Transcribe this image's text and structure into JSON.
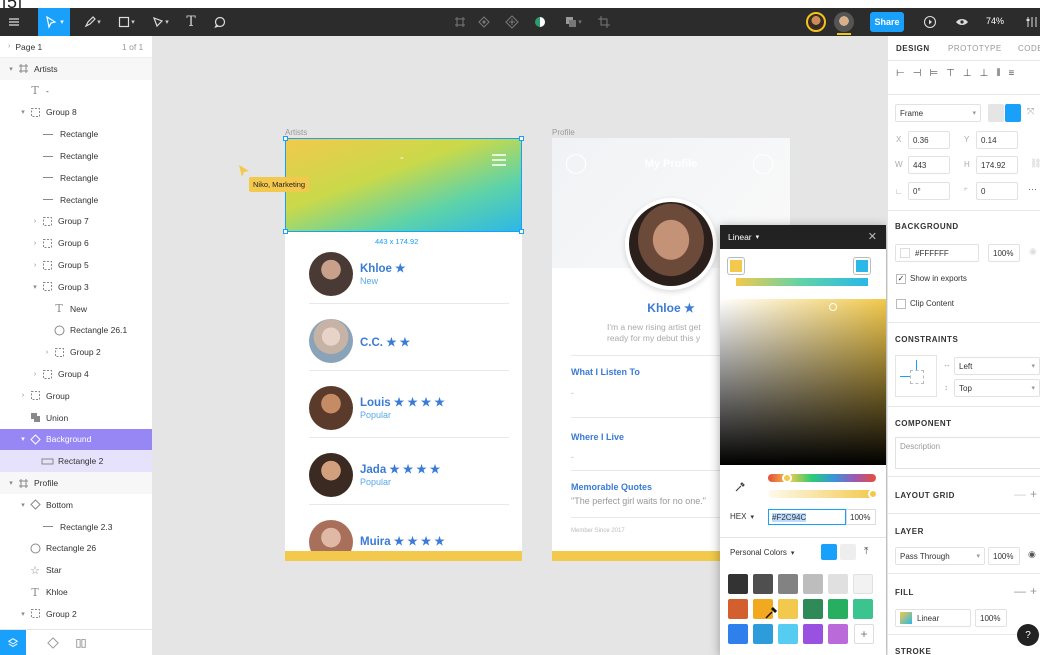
{
  "toolbar": {
    "share_label": "Share",
    "zoom": "74%"
  },
  "left_panel": {
    "page_name": "Page 1",
    "page_count": "1 of 1",
    "layers": [
      {
        "label": "Artists",
        "depth": 0,
        "icon": "frame-icon",
        "arrow": "▾",
        "state": "frame"
      },
      {
        "label": "-",
        "depth": 1,
        "icon": "text-icon",
        "arrow": "",
        "state": ""
      },
      {
        "label": "Group 8",
        "depth": 1,
        "icon": "group-icon",
        "arrow": "▾",
        "state": ""
      },
      {
        "label": "Rectangle",
        "depth": 2,
        "icon": "line-icon",
        "arrow": "",
        "state": ""
      },
      {
        "label": "Rectangle",
        "depth": 2,
        "icon": "line-icon",
        "arrow": "",
        "state": ""
      },
      {
        "label": "Rectangle",
        "depth": 2,
        "icon": "line-icon",
        "arrow": "",
        "state": ""
      },
      {
        "label": "Rectangle",
        "depth": 2,
        "icon": "line-icon",
        "arrow": "",
        "state": ""
      },
      {
        "label": "Group 7",
        "depth": 2,
        "icon": "group-icon",
        "arrow": "›",
        "state": ""
      },
      {
        "label": "Group 6",
        "depth": 2,
        "icon": "group-icon",
        "arrow": "›",
        "state": ""
      },
      {
        "label": "Group 5",
        "depth": 2,
        "icon": "group-icon",
        "arrow": "›",
        "state": ""
      },
      {
        "label": "Group 3",
        "depth": 2,
        "icon": "group-icon",
        "arrow": "▾",
        "state": ""
      },
      {
        "label": "New",
        "depth": 3,
        "icon": "text-icon",
        "arrow": "",
        "state": ""
      },
      {
        "label": "Rectangle 26.1",
        "depth": 3,
        "icon": "ellipse-icon",
        "arrow": "",
        "state": ""
      },
      {
        "label": "Group 2",
        "depth": 3,
        "icon": "group-icon",
        "arrow": "›",
        "state": ""
      },
      {
        "label": "Group 4",
        "depth": 2,
        "icon": "group-icon",
        "arrow": "›",
        "state": ""
      },
      {
        "label": "Group",
        "depth": 1,
        "icon": "group-icon",
        "arrow": "›",
        "state": ""
      },
      {
        "label": "Union",
        "depth": 1,
        "icon": "union-icon",
        "arrow": "",
        "state": ""
      },
      {
        "label": "Background",
        "depth": 1,
        "icon": "component-icon",
        "arrow": "▾",
        "state": "sel"
      },
      {
        "label": "Rectangle 2",
        "depth": 2,
        "icon": "rect-icon",
        "arrow": "",
        "state": "sub"
      },
      {
        "label": "Profile",
        "depth": 0,
        "icon": "frame-icon",
        "arrow": "▾",
        "state": "frame"
      },
      {
        "label": "Bottom",
        "depth": 1,
        "icon": "component-icon",
        "arrow": "▾",
        "state": ""
      },
      {
        "label": "Rectangle 2.3",
        "depth": 2,
        "icon": "line-icon",
        "arrow": "",
        "state": ""
      },
      {
        "label": "Rectangle 26",
        "depth": 1,
        "icon": "ellipse-icon",
        "arrow": "",
        "state": ""
      },
      {
        "label": "Star",
        "depth": 1,
        "icon": "star-icon",
        "arrow": "",
        "state": ""
      },
      {
        "label": "Khloe",
        "depth": 1,
        "icon": "text-icon",
        "arrow": "",
        "state": ""
      },
      {
        "label": "Group 2",
        "depth": 1,
        "icon": "group-icon",
        "arrow": "▾",
        "state": ""
      }
    ]
  },
  "canvas": {
    "artists_frame_label": "Artists",
    "profile_frame_label": "Profile",
    "cursor_label": "Niko, Marketing",
    "size_label": "443 x 174.92",
    "header_dash": "-",
    "artists": [
      {
        "name": "Khloe ★",
        "tag": "New"
      },
      {
        "name": "C.C.  ★ ★",
        "tag": ""
      },
      {
        "name": "Louis ★ ★ ★ ★",
        "tag": "Popular"
      },
      {
        "name": "Jada  ★ ★ ★ ★",
        "tag": "Popular"
      },
      {
        "name": "Muira ★ ★ ★ ★",
        "tag": ""
      }
    ],
    "profile": {
      "title": "My Profile",
      "name": "Khloe ★",
      "bio_line1": "I'm a new rising artist get",
      "bio_line2": "ready for my debut this y",
      "sections": [
        {
          "title": "What I Listen To",
          "body": "-"
        },
        {
          "title": "Where I Live",
          "body": "-"
        },
        {
          "title": "Memorable Quotes",
          "body": "\"The perfect girl waits for no one.\""
        }
      ],
      "member_since": "Member Since 2017"
    }
  },
  "picker": {
    "mode": "Linear",
    "stop_left_color": "#F2C94C",
    "stop_right_color": "#2BB7E8",
    "format": "HEX",
    "hex_value": "#F2C94C",
    "opacity": "100%",
    "library": "Personal Colors",
    "palette_row1": [
      "#333333",
      "#4f4f4f",
      "#828282",
      "#bdbdbd",
      "#e0e0e0",
      "#f2f2f2"
    ],
    "palette_row2": [
      "#d35f2e",
      "#f2a91f",
      "#f2c94c",
      "#2e8b57",
      "#27ae60",
      "#3bc48f"
    ],
    "palette_row3": [
      "#2f80ed",
      "#2d9cdb",
      "#56ccf2",
      "#9b51e0",
      "#bb6bd9"
    ]
  },
  "right_panel": {
    "tabs": [
      "DESIGN",
      "PROTOTYPE",
      "CODE"
    ],
    "frame_type": "Frame",
    "x": "0.36",
    "y": "0.14",
    "w": "443",
    "h": "174.92",
    "rotation": "0°",
    "radius": "0",
    "background_title": "BACKGROUND",
    "background_hex": "#FFFFFF",
    "background_opacity": "100%",
    "show_in_exports": "Show in exports",
    "clip_content": "Clip Content",
    "constraints_title": "CONSTRAINTS",
    "constraint_h": "Left",
    "constraint_v": "Top",
    "component_title": "COMPONENT",
    "description_placeholder": "Description",
    "layout_grid_title": "LAYOUT GRID",
    "layer_title": "LAYER",
    "blend_mode": "Pass Through",
    "layer_opacity": "100%",
    "fill_title": "FILL",
    "fill_type": "Linear",
    "fill_opacity": "100%",
    "stroke_title": "STROKE"
  }
}
